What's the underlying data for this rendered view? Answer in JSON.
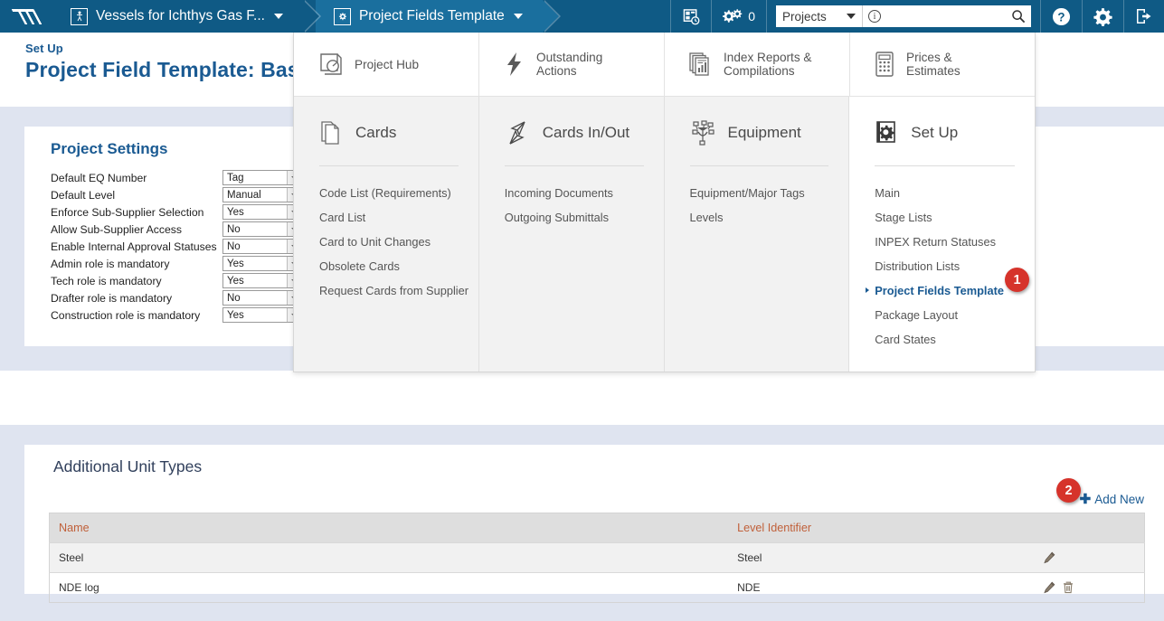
{
  "topbar": {
    "menu_icon": "chevrons-right-icon",
    "tabs": [
      {
        "label": "Vessels for Ichthys Gas F...",
        "icon": "person-box-icon",
        "active": false
      },
      {
        "label": "Project Fields Template",
        "icon": "gear-box-icon",
        "active": true
      }
    ],
    "reports_icon": "report-clock-icon",
    "settings_gears_icon": "gears-icon",
    "settings_count": "0",
    "project_select": {
      "value": "Projects",
      "icon": "chevron-down-icon"
    },
    "search": {
      "placeholder": "",
      "value": "",
      "info_icon": "info-circle-icon",
      "search_icon": "search-icon"
    },
    "help_icon": "question-circle-icon",
    "gear_icon": "gear-icon",
    "logout_icon": "logout-icon",
    "background_color": "#0f5a85",
    "active_tab_color": "#1a6f9e"
  },
  "page_header": {
    "breadcrumb": "Set Up",
    "title": "Project Field Template: Basic Sh",
    "title_color": "#1a5a92"
  },
  "megamenu": {
    "top_items": [
      {
        "label": "Project Hub",
        "icon": "dashboard-gauge-icon"
      },
      {
        "label": "Outstanding Actions",
        "icon": "lightning-bolt-icon"
      },
      {
        "label": "Index Reports & Compilations",
        "icon": "stacked-reports-icon"
      },
      {
        "label": "Prices & Estimates",
        "icon": "calculator-icon"
      }
    ],
    "columns": [
      {
        "heading": "Cards",
        "icon": "cards-stack-icon",
        "active": false,
        "items": [
          "Code List (Requirements)",
          "Card List",
          "Card to Unit Changes",
          "Obsolete Cards",
          "Request Cards from Supplier"
        ]
      },
      {
        "heading": "Cards In/Out",
        "icon": "paper-planes-icon",
        "active": false,
        "items": [
          "Incoming Documents",
          "Outgoing Submittals"
        ]
      },
      {
        "heading": "Equipment",
        "icon": "equipment-nodes-icon",
        "active": false,
        "items": [
          "Equipment/Major Tags",
          "Levels"
        ]
      },
      {
        "heading": "Set Up",
        "icon": "gear-page-icon",
        "active": true,
        "items": [
          "Main",
          "Stage Lists",
          "INPEX Return Statuses",
          "Distribution Lists",
          "Project Fields Template",
          "Package Layout",
          "Card States"
        ],
        "selected_item": "Project Fields Template"
      }
    ]
  },
  "project_settings": {
    "heading": "Project Settings",
    "fields": [
      {
        "label": "Default EQ Number",
        "value": "Tag"
      },
      {
        "label": "Default Level",
        "value": "Manual"
      },
      {
        "label": "Enforce Sub-Supplier Selection",
        "value": "Yes"
      },
      {
        "label": "Allow Sub-Supplier Access",
        "value": "No"
      },
      {
        "label": "Enable Internal Approval Statuses",
        "value": "No"
      },
      {
        "label": "Admin role is mandatory",
        "value": "Yes"
      },
      {
        "label": "Tech role is mandatory",
        "value": "Yes"
      },
      {
        "label": "Drafter role is mandatory",
        "value": "No"
      },
      {
        "label": "Construction role is mandatory",
        "value": "Yes"
      }
    ]
  },
  "additional_unit_types": {
    "heading": "Additional Unit Types",
    "add_new_label": "Add New",
    "columns": [
      "Name",
      "Level Identifier",
      ""
    ],
    "rows": [
      {
        "name": "Steel",
        "level_identifier": "Steel",
        "actions": [
          "edit-icon"
        ]
      },
      {
        "name": "NDE log",
        "level_identifier": "NDE",
        "actions": [
          "edit-icon",
          "delete-icon"
        ]
      }
    ],
    "header_text_color": "#c0603a"
  },
  "badges": [
    {
      "number": "1",
      "target": "Project Fields Template menu item"
    },
    {
      "number": "2",
      "target": "Add New link"
    }
  ]
}
